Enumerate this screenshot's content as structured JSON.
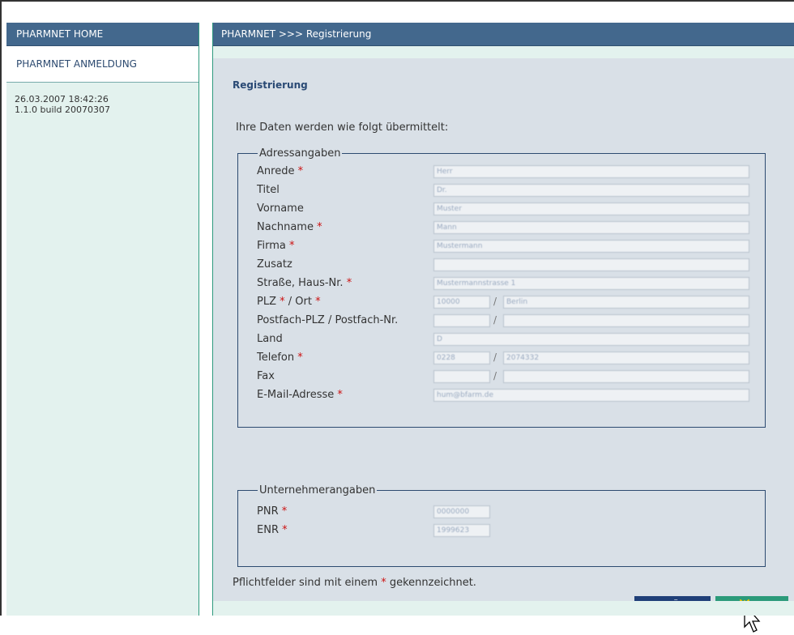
{
  "sidebar": {
    "header": "PHARMNET HOME",
    "items": [
      {
        "label": "PHARMNET ANMELDUNG"
      }
    ],
    "timestamp": "26.03.2007 18:42:26",
    "build": "1.1.0 build 20070307"
  },
  "main": {
    "breadcrumb": "PHARMNET >>> Registrierung",
    "title": "Registrierung",
    "intro": "Ihre Daten werden wie folgt übermittelt:",
    "address_legend": "Adressangaben",
    "address_fields": [
      {
        "label": "Anrede",
        "required": "*",
        "value": "Herr"
      },
      {
        "label": "Titel",
        "required": "",
        "value": "Dr."
      },
      {
        "label": "Vorname",
        "required": "",
        "value": "Muster"
      },
      {
        "label": "Nachname",
        "required": "*",
        "value": "Mann"
      },
      {
        "label": "Firma",
        "required": "*",
        "value": "Mustermann"
      },
      {
        "label": "Zusatz",
        "required": "",
        "value": ""
      },
      {
        "label": "Straße, Haus-Nr.",
        "required": "*",
        "value": "Mustermannstrasse 1"
      },
      {
        "label": "PLZ",
        "required": "*",
        "label2": "/ Ort",
        "required2": "*",
        "value": "10000",
        "value2": "Berlin"
      },
      {
        "label": "Postfach-PLZ / Postfach-Nr.",
        "required": "",
        "value": "",
        "value2": ""
      },
      {
        "label": "Land",
        "required": "",
        "value": "D"
      },
      {
        "label": "Telefon",
        "required": "*",
        "value": "0228",
        "value2": "2074332"
      },
      {
        "label": "Fax",
        "required": "",
        "value": "",
        "value2": ""
      },
      {
        "label": "E-Mail-Adresse",
        "required": "*",
        "value": "hum@bfarm.de"
      }
    ],
    "company_legend": "Unternehmerangaben",
    "company_fields": [
      {
        "label": "PNR",
        "required": "*",
        "value": "0000000"
      },
      {
        "label": "ENR",
        "required": "*",
        "value": "1999623"
      }
    ],
    "note_prefix": "Pflichtfelder sind mit einem",
    "note_star": "*",
    "note_suffix": "gekennzeichnet.",
    "back_label": "ZURÜCK",
    "next_label": "WEITER"
  }
}
